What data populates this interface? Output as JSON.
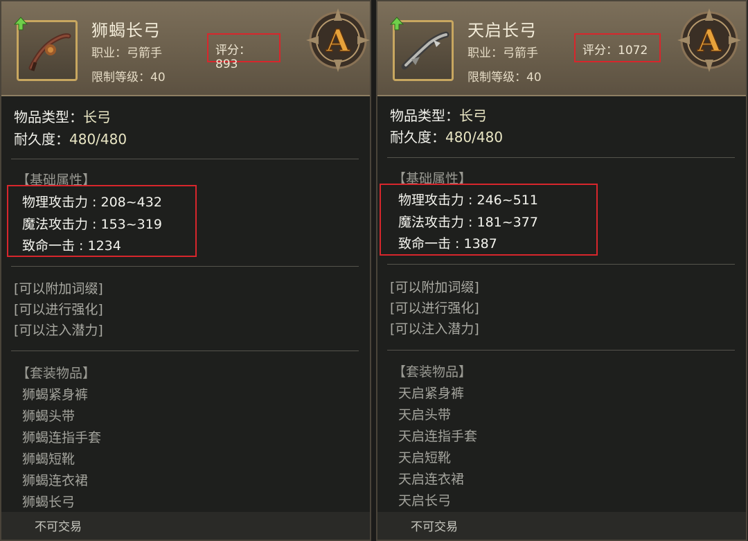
{
  "items": [
    {
      "name": "狮蝎长弓",
      "job": "职业：弓箭手",
      "level": "限制等级：40",
      "score": "评分：893",
      "grade": "A",
      "type_label": "物品类型：",
      "type_value": "长弓",
      "durability_label": "耐久度：",
      "durability_value": "480/480",
      "base_section": "【基础属性】",
      "stats": [
        "物理攻击力 : 208~432",
        "魔法攻击力 : 153~319",
        "致命一击 : 1234"
      ],
      "options": [
        "[可以附加词缀]",
        "[可以进行强化]",
        "[可以注入潜力]"
      ],
      "set_section": "【套装物品】",
      "set_items": [
        "狮蝎紧身裤",
        "狮蝎头带",
        "狮蝎连指手套",
        "狮蝎短靴",
        "狮蝎连衣裙",
        "狮蝎长弓"
      ],
      "trade": "不可交易",
      "icon": "bow-icon"
    },
    {
      "name": "天启长弓",
      "job": "职业：弓箭手",
      "level": "限制等级：40",
      "score": "评分：1072",
      "grade": "A",
      "type_label": "物品类型：",
      "type_value": "长弓",
      "durability_label": "耐久度：",
      "durability_value": "480/480",
      "base_section": "【基础属性】",
      "stats": [
        "物理攻击力 : 246~511",
        "魔法攻击力 : 181~377",
        "致命一击 : 1387"
      ],
      "options": [
        "[可以附加词缀]",
        "[可以进行强化]",
        "[可以注入潜力]"
      ],
      "set_section": "【套装物品】",
      "set_items": [
        "天启紧身裤",
        "天启头带",
        "天启连指手套",
        "天启短靴",
        "天启连衣裙",
        "天启长弓"
      ],
      "trade": "不可交易",
      "icon": "bow-icon"
    }
  ],
  "colors": {
    "highlight_border": "#d8262c",
    "grade_gold": "#e7a23a",
    "header_bg": "#6b5f4c"
  }
}
